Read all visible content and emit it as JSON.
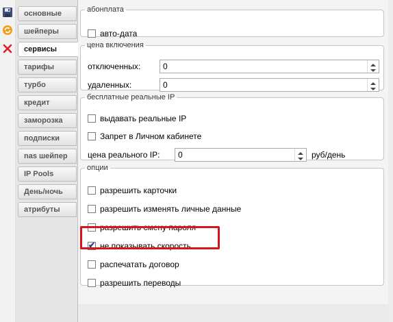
{
  "toolbar": {
    "icons": [
      "save-icon",
      "refresh-icon",
      "close-icon"
    ]
  },
  "tabs": [
    {
      "label": "основные",
      "active": false
    },
    {
      "label": "шейперы",
      "active": false
    },
    {
      "label": "сервисы",
      "active": true
    },
    {
      "label": "тарифы",
      "active": false
    },
    {
      "label": "турбо",
      "active": false
    },
    {
      "label": "кредит",
      "active": false
    },
    {
      "label": "заморозка",
      "active": false
    },
    {
      "label": "подписки",
      "active": false
    },
    {
      "label": "nas шейпер",
      "active": false
    },
    {
      "label": "IP Pools",
      "active": false
    },
    {
      "label": "День/ночь",
      "active": false
    },
    {
      "label": "атрибуты",
      "active": false
    }
  ],
  "subscription": {
    "legend": "абонплата",
    "auto_date": {
      "label": "авто-дата",
      "checked": false
    }
  },
  "price_enable": {
    "legend": "цена включения",
    "disabled": {
      "label": "отключенных:",
      "value": "0"
    },
    "deleted": {
      "label": "удаленных:",
      "value": "0"
    }
  },
  "free_ip": {
    "legend": "бесплатные реальные IP",
    "issue_real_ip": {
      "label": "выдавать реальные IP",
      "checked": false
    },
    "cabinet_ban": {
      "label": "Запрет в Личном кабинете",
      "checked": false
    },
    "price": {
      "label": "цена реального IP:",
      "value": "0",
      "unit": "руб/день"
    }
  },
  "options": {
    "legend": "опции",
    "items": [
      {
        "label": "разрешить карточки",
        "checked": false
      },
      {
        "label": "разрешить изменять личные данные",
        "checked": false
      },
      {
        "label": "разрешить смену пароля",
        "checked": false
      },
      {
        "label": "не показывать скорость",
        "checked": true
      },
      {
        "label": "распечатать договор",
        "checked": false
      },
      {
        "label": "разрешить переводы",
        "checked": false
      }
    ]
  },
  "colors": {
    "highlight": "#d4161b",
    "tick": "#1b3a8a"
  }
}
